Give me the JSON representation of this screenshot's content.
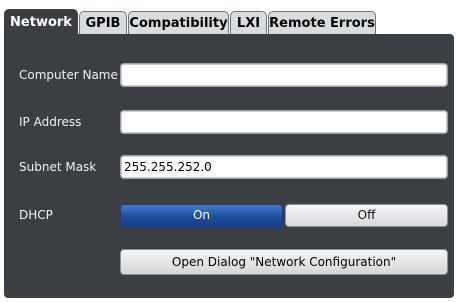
{
  "tabs": [
    {
      "label": "Network",
      "active": true
    },
    {
      "label": "GPIB",
      "active": false
    },
    {
      "label": "Compatibility",
      "active": false
    },
    {
      "label": "LXI",
      "active": false
    },
    {
      "label": "Remote Errors",
      "active": false
    }
  ],
  "fields": {
    "computer_name": {
      "label": "Computer Name",
      "value": ""
    },
    "ip_address": {
      "label": "IP Address",
      "value": ""
    },
    "subnet_mask": {
      "label": "Subnet Mask",
      "value": "255.255.252.0"
    }
  },
  "dhcp": {
    "label": "DHCP",
    "on_label": "On",
    "off_label": "Off",
    "selected": "On"
  },
  "dialog_button": {
    "label": "Open Dialog \"Network Configuration\""
  },
  "colors": {
    "panel_bg": "#3b3f44",
    "active_tab_bg": "#3b3f44",
    "inactive_tab_bg": "#d9dcdf",
    "toggle_selected": "#1f4e9c"
  }
}
